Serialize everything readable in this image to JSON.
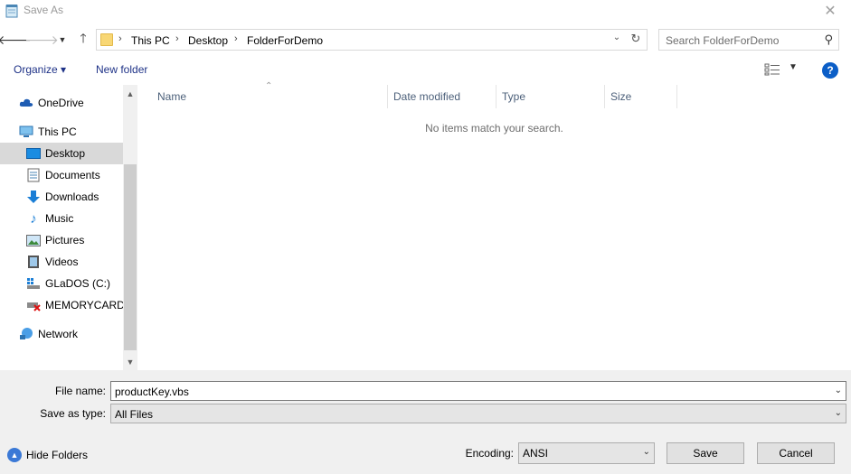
{
  "window": {
    "title": "Save As"
  },
  "address": {
    "crumbs": [
      "This PC",
      "Desktop",
      "FolderForDemo"
    ]
  },
  "search": {
    "placeholder": "Search FolderForDemo"
  },
  "toolbar": {
    "organize": "Organize ▾",
    "new_folder": "New folder",
    "help": "?"
  },
  "sidebar": {
    "items": [
      {
        "label": "OneDrive",
        "icon": "cloud-icon"
      },
      {
        "label": "This PC",
        "icon": "computer-icon"
      },
      {
        "label": "Desktop",
        "icon": "desktop-icon"
      },
      {
        "label": "Documents",
        "icon": "documents-icon"
      },
      {
        "label": "Downloads",
        "icon": "downloads-icon"
      },
      {
        "label": "Music",
        "icon": "music-icon"
      },
      {
        "label": "Pictures",
        "icon": "pictures-icon"
      },
      {
        "label": "Videos",
        "icon": "videos-icon"
      },
      {
        "label": "GLaDOS (C:)",
        "icon": "drive-icon"
      },
      {
        "label": "MEMORYCARD",
        "icon": "memory-card-icon"
      },
      {
        "label": "Network",
        "icon": "network-icon"
      }
    ],
    "selected": "Desktop"
  },
  "columns": [
    "Name",
    "Date modified",
    "Type",
    "Size"
  ],
  "empty_message": "No items match your search.",
  "form": {
    "file_name_label": "File name:",
    "file_name_value": "productKey.vbs",
    "type_label": "Save as type:",
    "type_value": "All Files",
    "encoding_label": "Encoding:",
    "encoding_value": "ANSI"
  },
  "buttons": {
    "hide_folders": "Hide Folders",
    "save": "Save",
    "cancel": "Cancel"
  },
  "colors": {
    "link": "#1e3287",
    "selected": "#d9d9d9",
    "header_text": "#4c607a",
    "help": "#0b5ec7"
  }
}
